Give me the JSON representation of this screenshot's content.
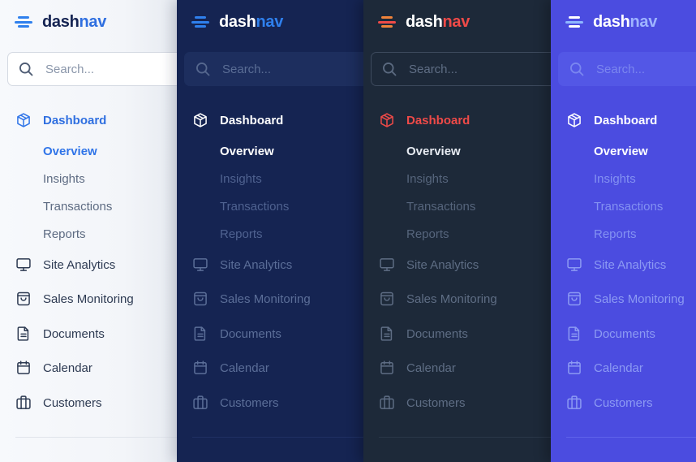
{
  "themes": [
    {
      "name": "light",
      "accent": "#2f74e8",
      "background": "#f3f5f9"
    },
    {
      "name": "navy",
      "accent": "#2f80ed",
      "background": "#152452"
    },
    {
      "name": "slate",
      "accent": "#ef4a48",
      "background": "#1d2939"
    },
    {
      "name": "indigo",
      "accent": "#ffffff",
      "background": "#4b4ce0"
    }
  ],
  "brand": {
    "part1": "dash",
    "part2": "nav",
    "icon": "menu-lines-icon"
  },
  "search": {
    "placeholder": "Search...",
    "icon": "search-icon"
  },
  "nav": {
    "dashboard": {
      "label": "Dashboard",
      "icon": "box-icon",
      "expanded": true
    },
    "sub_items": [
      {
        "label": "Overview",
        "active": true
      },
      {
        "label": "Insights",
        "active": false
      },
      {
        "label": "Transactions",
        "active": false
      },
      {
        "label": "Reports",
        "active": false
      }
    ],
    "items": [
      {
        "label": "Site Analytics",
        "icon": "monitor-icon"
      },
      {
        "label": "Sales Monitoring",
        "icon": "shopping-bag-icon"
      },
      {
        "label": "Documents",
        "icon": "document-icon"
      },
      {
        "label": "Calendar",
        "icon": "calendar-icon"
      },
      {
        "label": "Customers",
        "icon": "briefcase-icon"
      }
    ]
  }
}
